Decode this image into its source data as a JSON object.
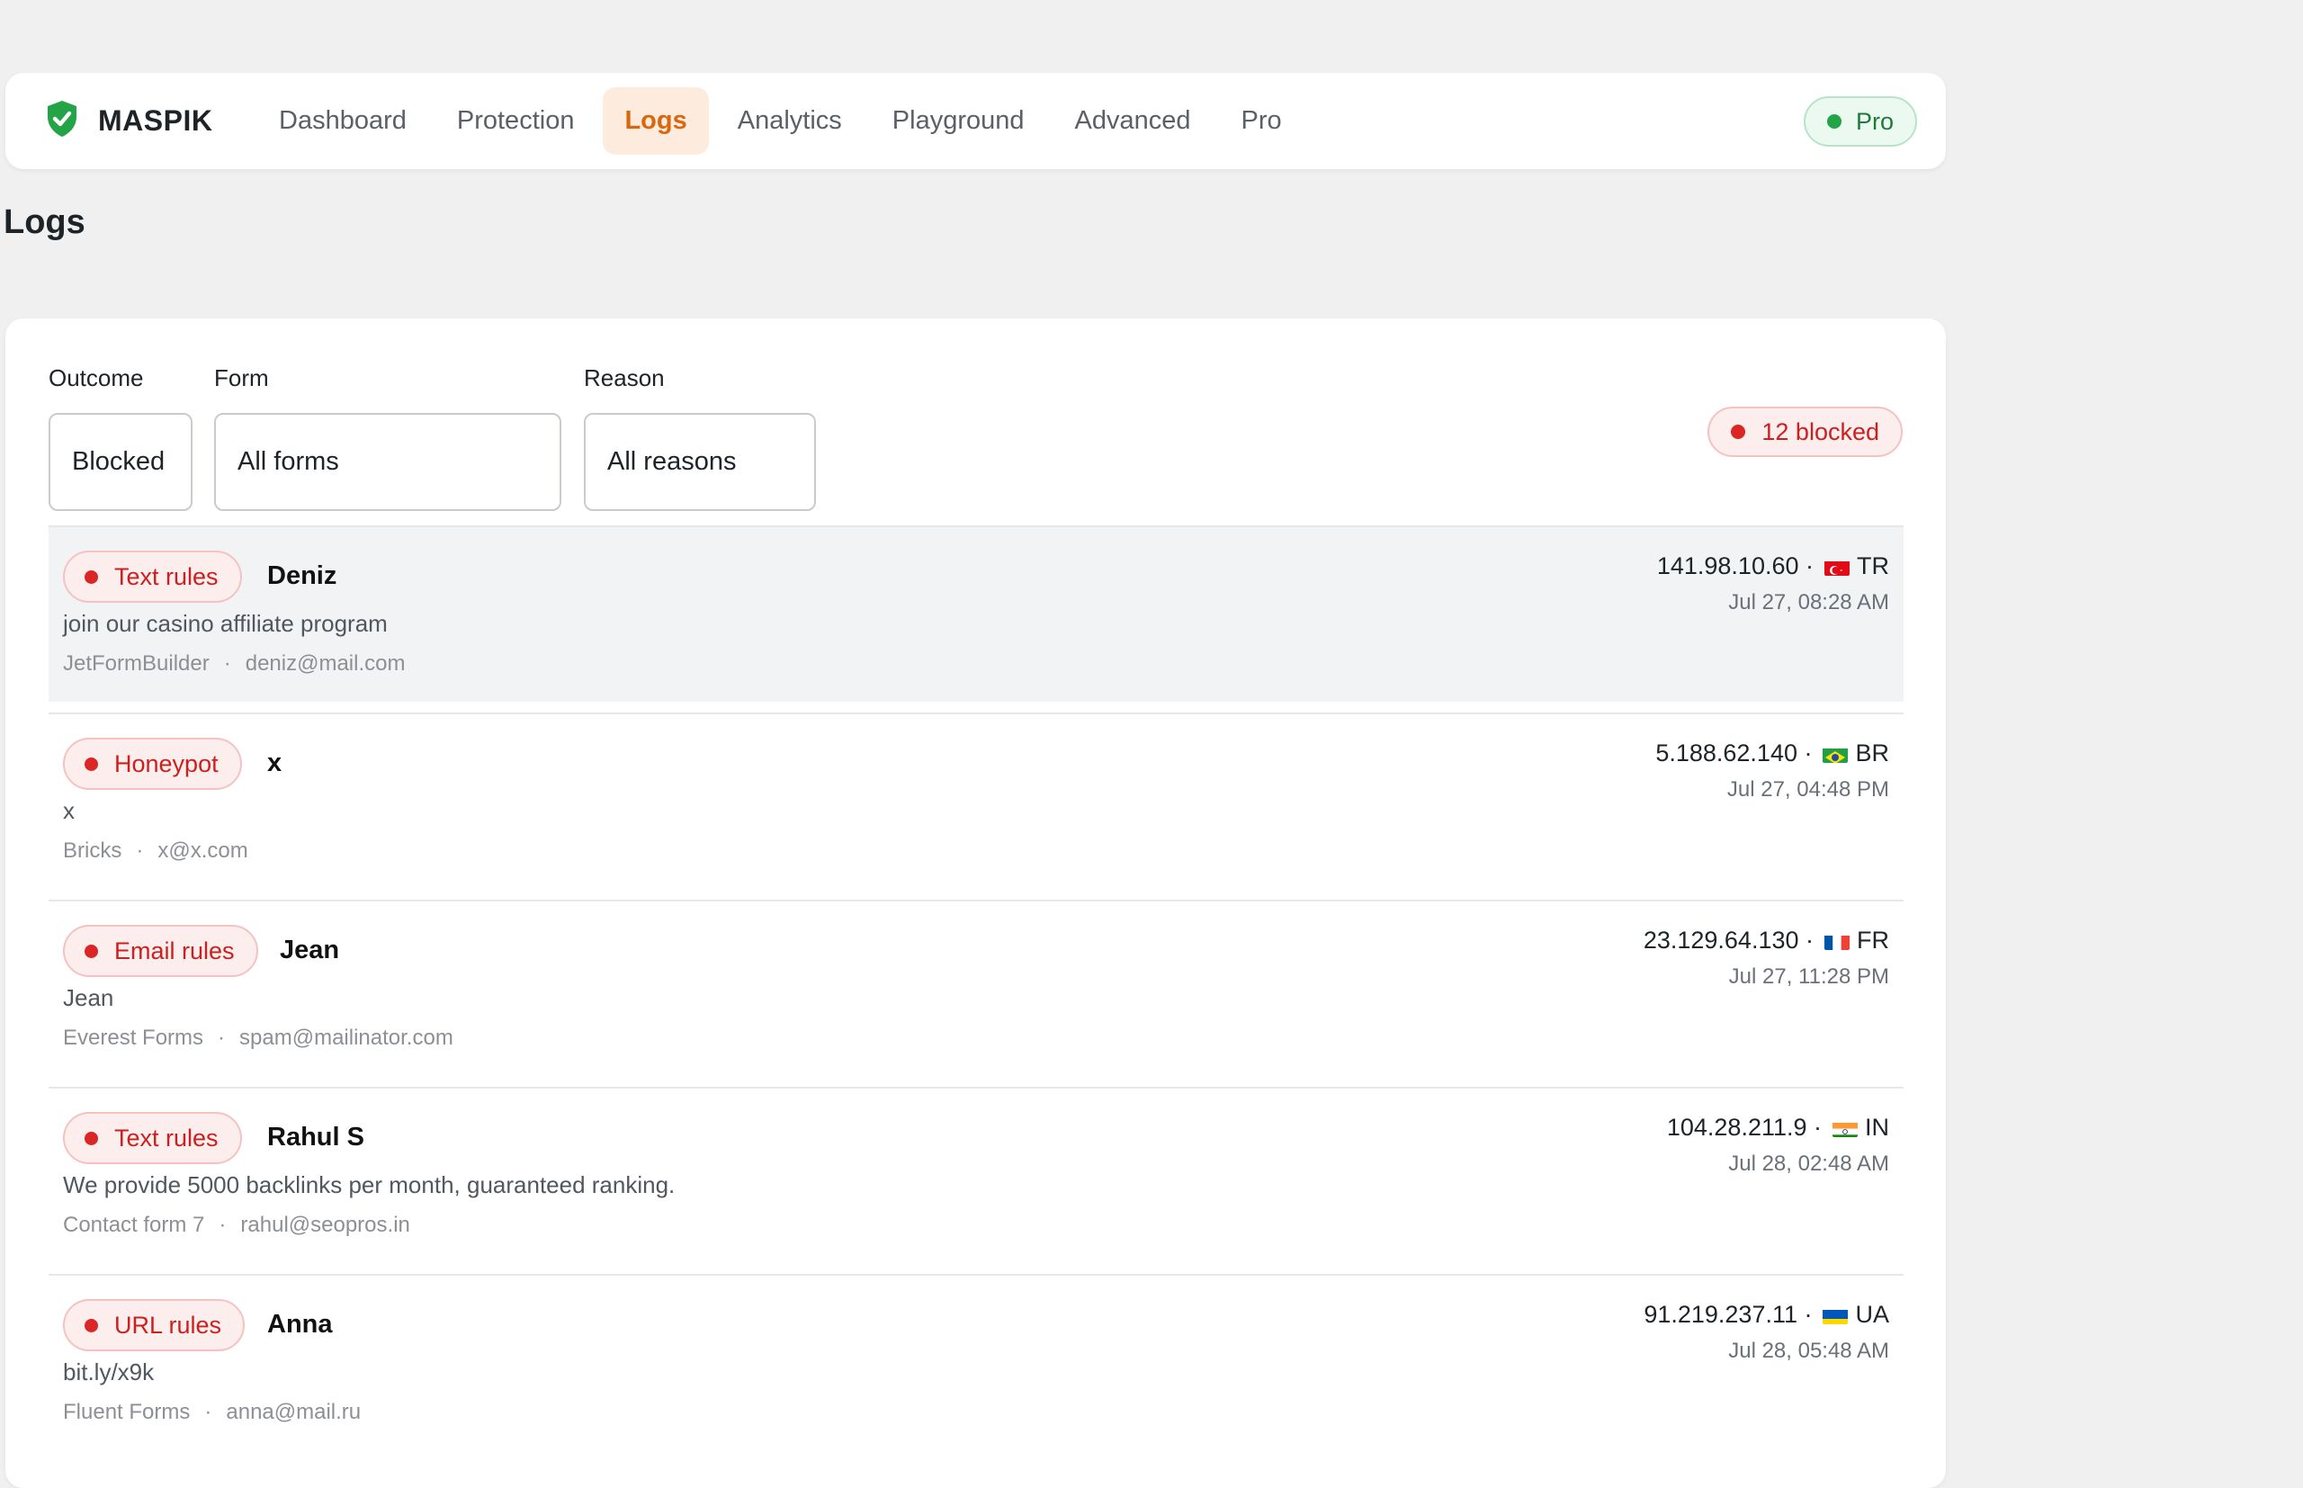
{
  "brand": {
    "name": "MASPIK",
    "color": "#22a447"
  },
  "nav": {
    "items": [
      {
        "label": "Dashboard",
        "active": false
      },
      {
        "label": "Protection",
        "active": false
      },
      {
        "label": "Logs",
        "active": true
      },
      {
        "label": "Analytics",
        "active": false
      },
      {
        "label": "Playground",
        "active": false
      },
      {
        "label": "Advanced",
        "active": false
      },
      {
        "label": "Pro",
        "active": false
      }
    ],
    "pro_badge": "Pro"
  },
  "page": {
    "title": "Logs"
  },
  "filters": {
    "outcome": {
      "label": "Outcome",
      "value": "Blocked"
    },
    "form": {
      "label": "Form",
      "value": "All forms"
    },
    "reason": {
      "label": "Reason",
      "value": "All reasons"
    }
  },
  "summary": {
    "blocked_count": "12 blocked"
  },
  "logs": [
    {
      "reason": "Text rules",
      "sender": "Deniz",
      "message": "join our casino affiliate program",
      "form": "JetFormBuilder",
      "email": "deniz@mail.com",
      "ip": "141.98.10.60 ·",
      "country": "TR",
      "flag_icon": "turkey-flag-icon",
      "time": "Jul 27, 08:28 AM"
    },
    {
      "reason": "Honeypot",
      "sender": "x",
      "message": "x",
      "form": "Bricks",
      "email": "x@x.com",
      "ip": "5.188.62.140 ·",
      "country": "BR",
      "flag_icon": "brazil-flag-icon",
      "time": "Jul 27, 04:48 PM"
    },
    {
      "reason": "Email rules",
      "sender": "Jean",
      "message": "Jean",
      "form": "Everest Forms",
      "email": "spam@mailinator.com",
      "ip": "23.129.64.130 ·",
      "country": "FR",
      "flag_icon": "france-flag-icon",
      "time": "Jul 27, 11:28 PM"
    },
    {
      "reason": "Text rules",
      "sender": "Rahul S",
      "message": "We provide 5000 backlinks per month, guaranteed ranking.",
      "form": "Contact form 7",
      "email": "rahul@seopros.in",
      "ip": "104.28.211.9 ·",
      "country": "IN",
      "flag_icon": "india-flag-icon",
      "time": "Jul 28, 02:48 AM"
    },
    {
      "reason": "URL rules",
      "sender": "Anna",
      "message": "bit.ly/x9k",
      "form": "Fluent Forms",
      "email": "anna@mail.ru",
      "ip": "91.219.237.11 ·",
      "country": "UA",
      "flag_icon": "ukraine-flag-icon",
      "time": "Jul 28, 05:48 AM"
    }
  ],
  "meta_separator": "·"
}
